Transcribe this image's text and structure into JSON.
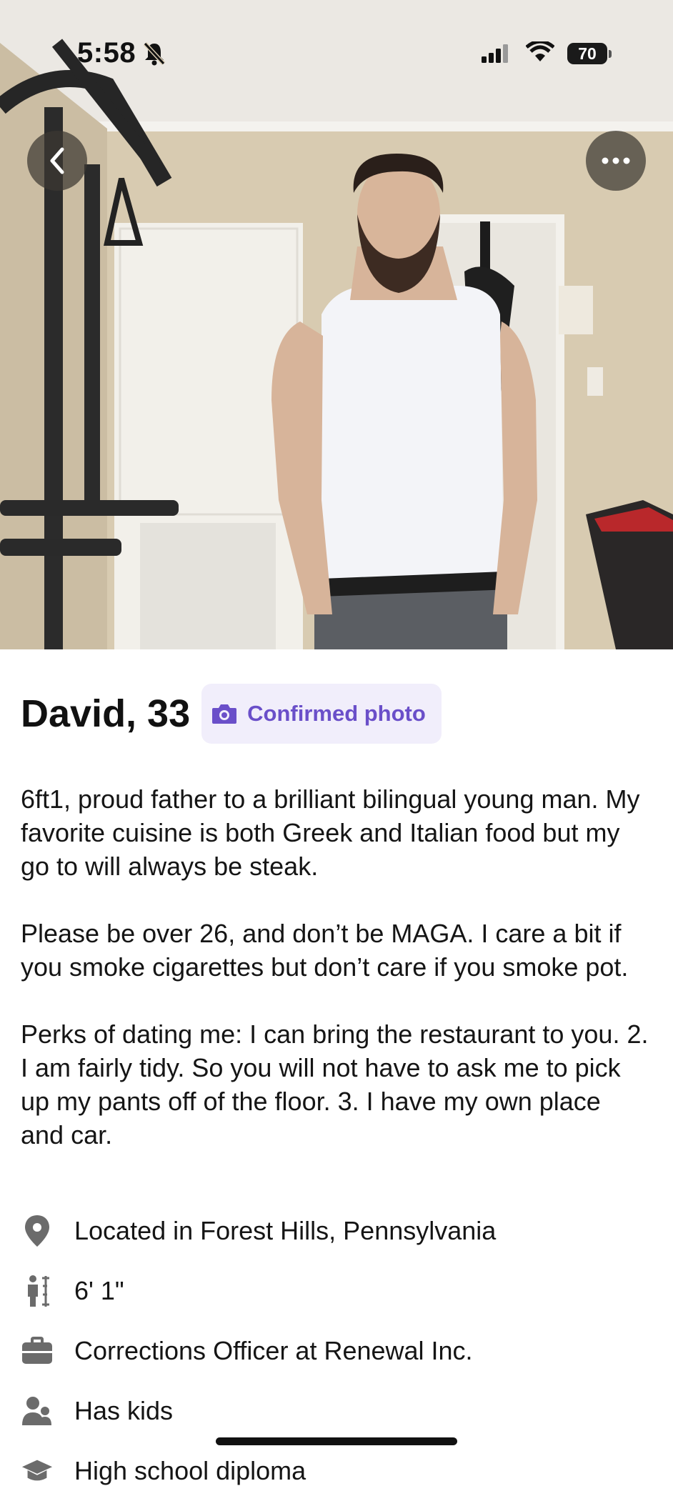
{
  "status_bar": {
    "time": "5:58",
    "battery": "70"
  },
  "profile": {
    "name_age": "David, 33",
    "badge_label": "Confirmed photo",
    "bio": [
      "6ft1, proud father to a brilliant bilingual young man. My favorite cuisine is both Greek and Italian food but my go to will always be steak.",
      "Please be over 26, and don’t be MAGA. I care a bit if you smoke cigarettes but don’t care if you smoke pot.",
      "Perks of dating me: I can bring the restaurant to you. 2. I am fairly tidy. So you will not have to ask me to pick up my pants off of the floor. 3. I have my own place and car."
    ],
    "details": [
      {
        "icon": "location-pin-icon",
        "text": "Located in Forest Hills, Pennsylvania"
      },
      {
        "icon": "height-icon",
        "text": "6' 1\""
      },
      {
        "icon": "briefcase-icon",
        "text": "Corrections Officer at Renewal Inc."
      },
      {
        "icon": "people-icon",
        "text": "Has kids"
      },
      {
        "icon": "graduation-cap-icon",
        "text": "High school diploma"
      }
    ]
  },
  "colors": {
    "badge_bg": "#f1eefb",
    "badge_text": "#6a4fc9",
    "icon_gray": "#6b6b6b"
  }
}
